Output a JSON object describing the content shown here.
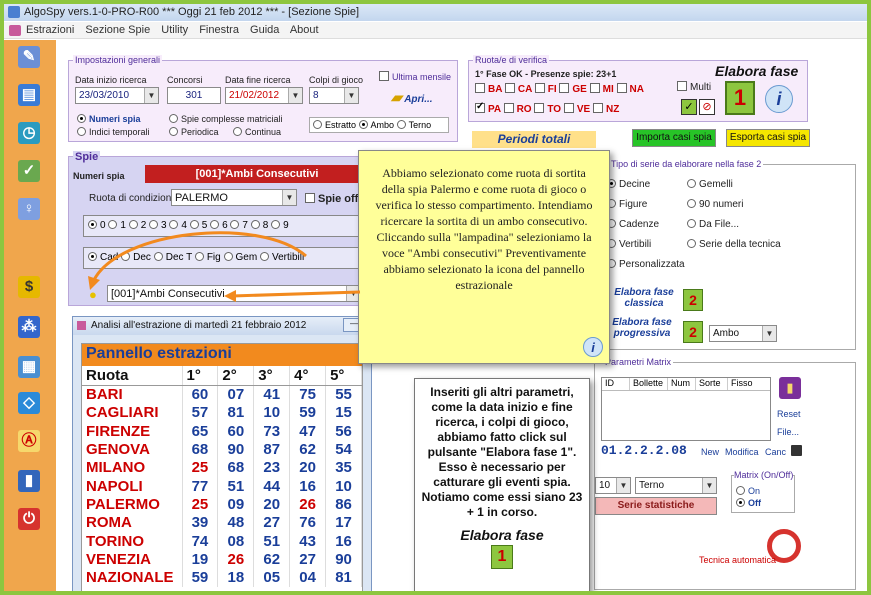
{
  "window": {
    "title": "AlgoSpy vers.1-0-PRO-R00  ***  Oggi 21 feb 2012  ***  - [Sezione Spie]"
  },
  "menu": [
    "Estrazioni",
    "Sezione Spie",
    "Utility",
    "Finestra",
    "Guida",
    "About"
  ],
  "sidebar_icons": [
    "pencil-icon",
    "sheets-icon",
    "clock-icon",
    "chart-icon",
    "lightbulb-icon",
    "dollar-icon",
    "pyramid-icon",
    "grid-icon",
    "compass-icon",
    "compass2-icon",
    "book-icon",
    "power-icon"
  ],
  "impostazioni": {
    "legend": "Impostazioni generali",
    "data_inizio_label": "Data inizio ricerca",
    "data_inizio": "23/03/2010",
    "concorsi_label": "Concorsi",
    "concorsi": "301",
    "data_fine_label": "Data fine ricerca",
    "data_fine": "21/02/2012",
    "colpi_label": "Colpi di gioco",
    "colpi": "8",
    "ultima_mensile": "Ultima mensile",
    "apri": "Apri...",
    "r_numeri_spia": "Numeri spia",
    "r_indici": "Indici temporali",
    "r_spie_complesse": "Spie complesse matriciali",
    "r_periodica": "Periodica",
    "r_continua": "Continua",
    "r_estratto": "Estratto",
    "r_ambo": "Ambo",
    "r_terno": "Terno"
  },
  "ruota_verifica": {
    "legend": "Ruota/e di verifica",
    "status": "1° Fase OK - Presenze spie: 23+1",
    "row1": [
      "BA",
      "CA",
      "FI",
      "GE",
      "MI",
      "NA"
    ],
    "row2": [
      "PA",
      "RO",
      "TO",
      "VE",
      "NZ"
    ],
    "multi": "Multi",
    "elabora": "Elabora fase",
    "elabora_num": "1"
  },
  "periodi_totali": "Periodi totali",
  "importa": "Importa casi spia",
  "esporta": "Esporta casi spia",
  "spie": {
    "legend": "Spie",
    "numeri_spia_label": "Numeri spia",
    "spy_name": "[001]*Ambi Consecutivi",
    "ruota_label": "Ruota di condizione",
    "ruota": "PALERMO",
    "spie_off": "Spie off",
    "digits": [
      "0",
      "1",
      "2",
      "3",
      "4",
      "5",
      "6",
      "7",
      "8",
      "9"
    ],
    "modes": [
      "Cad",
      "Dec",
      "Dec T",
      "Fig",
      "Gem",
      "Vertibili"
    ],
    "selected": "[001]*Ambi Consecutivi"
  },
  "tipo_serie": {
    "legend": "Tipo di serie da elaborare nella fase 2",
    "col1": [
      "Decine",
      "Figure",
      "Cadenze",
      "Vertibili",
      "Personalizzata"
    ],
    "col2": [
      "Gemelli",
      "90 numeri",
      "Da File...",
      "Serie della tecnica"
    ],
    "classica": "Elabora fase classica",
    "progressiva": "Elabora fase progressiva",
    "num": "2",
    "prog_select": "Ambo"
  },
  "matrix": {
    "legend": "Parametri Matrix",
    "cols": [
      "ID",
      "Bollette",
      "Num",
      "Sorte",
      "Fisso"
    ],
    "reset": "Reset",
    "file": "File...",
    "code": "01.2.2.2.08",
    "new": "New",
    "modifica": "Modifica",
    "canc": "Canc",
    "colpi": "10",
    "sorte": "Terno",
    "serie_stat": "Serie statistiche",
    "onoff_legend": "Matrix (On/Off)",
    "on": "On",
    "off": "Off",
    "tecnica": "Tecnica automatica"
  },
  "analisi_window": {
    "title": "Analisi all'estrazione di martedì 21 febbraio 2012",
    "panel_title": "Pannello estrazioni",
    "headers": [
      "Ruota",
      "1°",
      "2°",
      "3°",
      "4°",
      "5°"
    ],
    "rows": [
      [
        "BARI",
        "60",
        "07",
        "41",
        "75",
        "55"
      ],
      [
        "CAGLIARI",
        "57",
        "81",
        "10",
        "59",
        "15"
      ],
      [
        "FIRENZE",
        "65",
        "60",
        "73",
        "47",
        "56"
      ],
      [
        "GENOVA",
        "68",
        "90",
        "87",
        "62",
        "54"
      ],
      [
        "MILANO",
        "25",
        "68",
        "23",
        "20",
        "35"
      ],
      [
        "NAPOLI",
        "77",
        "51",
        "44",
        "16",
        "10"
      ],
      [
        "PALERMO",
        "25",
        "09",
        "20",
        "26",
        "86"
      ],
      [
        "ROMA",
        "39",
        "48",
        "27",
        "76",
        "17"
      ],
      [
        "TORINO",
        "74",
        "08",
        "51",
        "43",
        "16"
      ],
      [
        "VENEZIA",
        "19",
        "26",
        "62",
        "27",
        "90"
      ],
      [
        "NAZIONALE",
        "59",
        "18",
        "05",
        "04",
        "81"
      ]
    ],
    "red_cells": [
      [
        4,
        1
      ],
      [
        6,
        1
      ],
      [
        6,
        4
      ],
      [
        9,
        2
      ]
    ]
  },
  "callout1": "Abbiamo selezionato come ruota di sortita della spia Palermo e come ruota di gioco o verifica lo stesso compartimento. Intendiamo ricercare la sortita di un ambo consecutivo. Cliccando sulla \"lampadina\" selezioniamo la voce \"Ambi consecutivi\" Preventivamente abbiamo selezionato la icona del pannello estrazionale",
  "callout2": "Inseriti gli altri parametri, come la data inizio e fine ricerca, i colpi di gioco, abbiamo fatto click sul pulsante \"Elabora fase 1\". Esso è necessario per catturare gli eventi spia. Notiamo come essi siano 23 + 1 in corso.",
  "callout2_btn": "Elabora fase",
  "callout2_num": "1"
}
